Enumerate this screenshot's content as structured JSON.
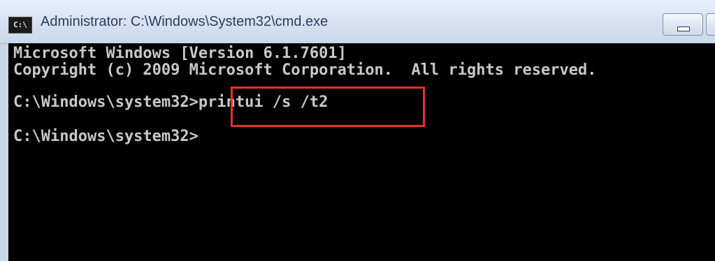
{
  "window": {
    "title": "Administrator: C:\\Windows\\System32\\cmd.exe",
    "icon_label": "C:\\"
  },
  "console": {
    "lines": [
      "Microsoft Windows [Version 6.1.7601]",
      "Copyright (c) 2009 Microsoft Corporation.  All rights reserved.",
      "C:\\Windows\\system32>printui /s /t2",
      "C:\\Windows\\system32>"
    ]
  },
  "annotation": {
    "color": "#e8302c"
  },
  "icons": {
    "app": "cmd-app-icon",
    "minimize": "minimize-icon"
  }
}
